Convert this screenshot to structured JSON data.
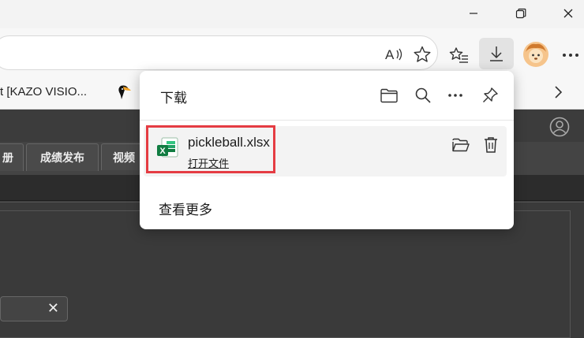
{
  "window": {
    "minimize_icon": "minimize-icon",
    "restore_icon": "restore-icon",
    "close_icon": "close-icon"
  },
  "toolbar": {
    "read_aloud_icon": "read-aloud-icon",
    "favorite_icon": "star-icon",
    "favorites_list_icon": "favorites-icon",
    "downloads_icon": "download-icon",
    "profile_icon": "profile-avatar",
    "more_icon": "more-icon"
  },
  "favorites_bar": {
    "item_text": "t [KAZO VISIO...",
    "chevron_icon": "chevron-right-icon"
  },
  "page": {
    "tabs": [
      "册",
      "成绩发布",
      "视频"
    ],
    "close_icon": "close-icon"
  },
  "downloads_panel": {
    "title": "下载",
    "header_icons": [
      "folder-icon",
      "search-icon",
      "more-icon",
      "pin-icon"
    ],
    "items": [
      {
        "file_name": "pickleball.xlsx",
        "action": "打开文件",
        "file_icon": "excel-file-icon"
      }
    ],
    "see_more": "查看更多"
  },
  "colors": {
    "highlight": "#e53c43",
    "excel_green": "#21a366"
  }
}
